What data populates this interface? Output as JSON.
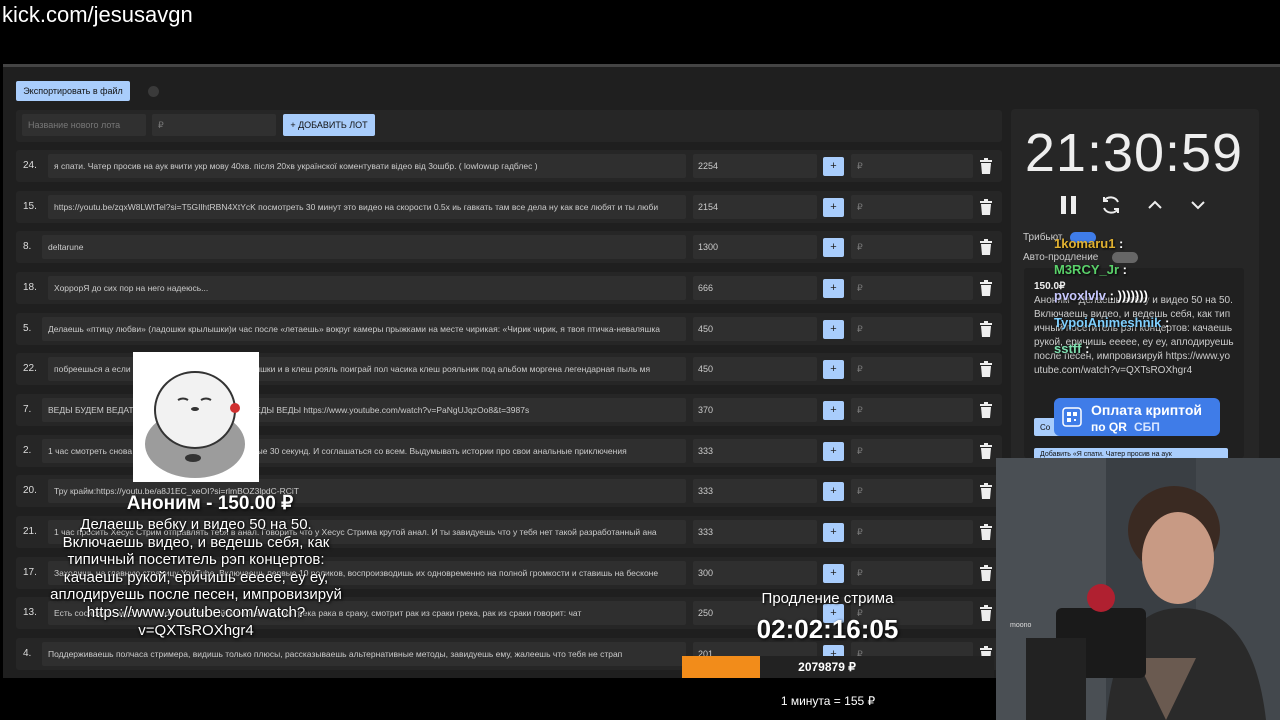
{
  "url": "kick.com/jesusavgn",
  "toolbar": {
    "export_label": "Экспортировать в файл"
  },
  "add_form": {
    "name_placeholder": "Название нового лота",
    "amount_placeholder": "₽",
    "add_label": "+ ДОБАВИТЬ ЛОТ"
  },
  "lots": [
    {
      "num": "24.",
      "name": "я спати. Чатер просив на аук вчити укр мову 40хв. після 20хв українскої коментувати відео від 3ошбр. ( lowlowup гадблес )",
      "amount": "2254"
    },
    {
      "num": "15.",
      "name": "https://youtu.be/zqxW8LWtTel?si=T5GIlhtRBN4XtYcK посмотреть 30 минут это видео на скорости 0.5x иь гавкать там все дела ну как все любят и ты люби",
      "amount": "2154"
    },
    {
      "num": "8.",
      "name": "deltarune",
      "amount": "1300"
    },
    {
      "num": "18.",
      "name": "ХоррорЯ до сих пор на него надеюсь...",
      "amount": "666"
    },
    {
      "num": "5.",
      "name": "Делаешь «птицу любви» (ладошки крылышки)и час после «летаешь» вокруг камеры прыжками на месте чирикая: «Чирик чирик, я твоя птичка-неваляшка",
      "amount": "450"
    },
    {
      "num": "22.",
      "name": "побреешься а если не заблокируют ладошки крылышки и в клеш рояль поиграй пол часика клеш рояльник под альбом моргена легендарная пыль мя",
      "amount": "450"
    },
    {
      "num": "7.",
      "name": "ВЕДЫ БУДЕМ ВЕДАТЬ ВЕДЫ ВЕДЫ ВЕДЫ ВЕДЫ ВЕДЫ ВЕДЫ https://www.youtube.com/watch?v=PaNgUJqzOo8&t=3987s",
      "amount": "370"
    },
    {
      "num": "2.",
      "name": "1 час смотреть снова и снова заставлять через каждые 30 секунд. И соглашаться со всем. Выдумывать истории про свои анальные приключения",
      "amount": "333"
    },
    {
      "num": "20.",
      "name": "Тру крайм:https://youtu.be/a8J1EC_xeOI?si=rlmBOZ3lpdC-RCiT",
      "amount": "333"
    },
    {
      "num": "21.",
      "name": "1 час просить Хесус Стрим отправлять тебя в анал. Говорить что у Хесус Стрима крутой анал. И ты завидуешь что у тебя нет такой разработанный ана",
      "amount": "333"
    },
    {
      "num": "17.",
      "name": "Заходишь на главную страницу YouTube. Включаешь первые 10 роликов, воспроизводишь их одновременно на полной громкости и ставишь на бесконе",
      "amount": "300"
    },
    {
      "num": "13.",
      "name": "Есть сосиску из мусорки и пожалуйста, пойти полчасаСунул грека рака в сраку, смотрит рак из сраки грека, рак из сраки говорит: чат",
      "amount": "250"
    },
    {
      "num": "4.",
      "name": "Поддерживаешь полчаса стримера, видишь только плюсы, рассказываешь альтернативные методы, завидуешь ему, жалеешь что тебя не страп",
      "amount": "201"
    }
  ],
  "lot_rub_placeholder": "₽",
  "timer": {
    "time": "21:30:59"
  },
  "settings": {
    "tribute_label": "Трибьют",
    "auto_extend_label": "Авто-продление"
  },
  "donation_box": {
    "amount": "150.0₽",
    "text": "Аноним - Делаешь вебку и видео 50 на 50. Включаешь видео, и ведешь себя, как типичный посетитель рэп концертов: качаешь рукой, еричишь еееее, еу еу, аплодируешь после песен, импровизируй https://www.youtube.com/watch?v=QXTsROXhgr4",
    "btn1": "Со",
    "btn2": "Добавить «Я спати. Чатер просив на аук"
  },
  "chat": [
    {
      "user": "1komaru1",
      "msg": ":",
      "color": "#e0b030"
    },
    {
      "user": "M3RCY_Jr",
      "msg": ":",
      "color": "#5ad16a"
    },
    {
      "user": "pvoxlvlv",
      "msg": ": )))))))",
      "color": "#c8c8ff"
    },
    {
      "user": "TypoiAnimeshnik",
      "msg": ":",
      "color": "#7fd0ff"
    },
    {
      "user": "sstff",
      "msg": ":",
      "color": "#7fe0b0"
    }
  ],
  "crypto": {
    "title": "Оплата криптой",
    "subtitle": "по QR",
    "tag": "СБП"
  },
  "alert": {
    "title": "Аноним - 150.00 ₽",
    "text": "Делаешь вебку и видео 50 на 50. Включаешь видео, и ведешь себя, как типичный посетитель рэп концертов: качаешь рукой, еричишь еееее, еу еу, аплодируешь после песен, импровизируй https://www.youtube.com/watch?v=QXTsROXhgr4"
  },
  "extension": {
    "label": "Продление стрима",
    "timer": "02:02:16:05"
  },
  "goal": {
    "total": "2079879 ₽",
    "progress": 0.25
  },
  "rate": {
    "text": "1 минута = 155 ₽"
  },
  "webcam": {
    "mic_label": "moono"
  },
  "colors": {
    "accent": "#a9cdfc",
    "panel": "#262626",
    "progress": "#f28c1a"
  }
}
